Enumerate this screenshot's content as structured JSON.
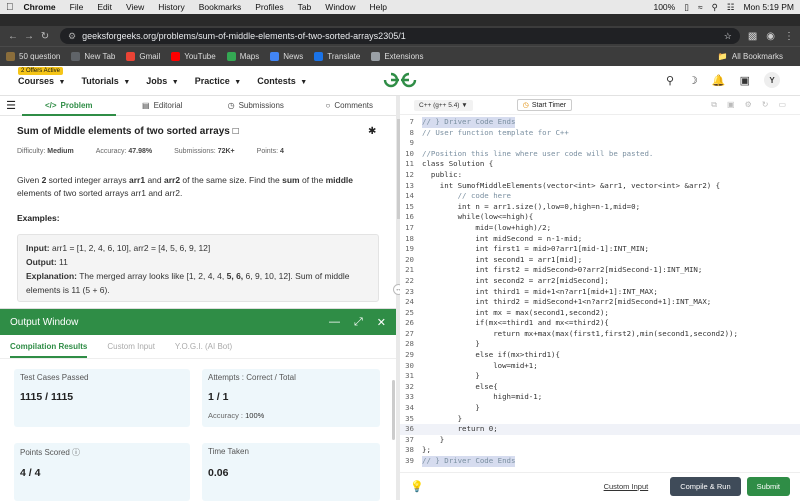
{
  "macbar": {
    "app": "Chrome",
    "menus": [
      "File",
      "Edit",
      "View",
      "History",
      "Bookmarks",
      "Profiles",
      "Tab",
      "Window",
      "Help"
    ],
    "battery": "100%",
    "clock": "Mon 5:19 PM"
  },
  "browser": {
    "url": "geeksforgeeks.org/problems/sum-of-middle-elements-of-two-sorted-arrays2305/1"
  },
  "bookmarks": [
    {
      "label": "50 question",
      "color": "#8a6d3b"
    },
    {
      "label": "New Tab",
      "color": "#5f6368"
    },
    {
      "label": "Gmail",
      "color": "#ea4335"
    },
    {
      "label": "YouTube",
      "color": "#ff0000"
    },
    {
      "label": "Maps",
      "color": "#34a853"
    },
    {
      "label": "News",
      "color": "#4285f4"
    },
    {
      "label": "Translate",
      "color": "#1a73e8"
    },
    {
      "label": "Extensions",
      "color": "#9aa0a6"
    }
  ],
  "all_bookmarks": "All Bookmarks",
  "nav": {
    "offer": "2 Offers Active",
    "courses": "Courses",
    "tutorials": "Tutorials",
    "jobs": "Jobs",
    "practice": "Practice",
    "contests": "Contests",
    "avatar": "Y"
  },
  "problem": {
    "tabs": {
      "problem": "Problem",
      "editorial": "Editorial",
      "submissions": "Submissions",
      "comments": "Comments"
    },
    "title": "Sum of Middle elements of two sorted arrays",
    "difficulty_label": "Difficulty:",
    "difficulty": "Medium",
    "accuracy_label": "Accuracy:",
    "accuracy": "47.98%",
    "submissions_label": "Submissions:",
    "submissions": "72K+",
    "points_label": "Points:",
    "points": "4",
    "desc": {
      "p1": "Given ",
      "p2": "2",
      "p3": " sorted integer arrays ",
      "p4": "arr1",
      "p5": " and ",
      "p6": "arr2",
      "p7": " of the same size. Find the ",
      "p8": "sum",
      "p9": " of the ",
      "p10": "middle",
      "p11": " elements of two sorted arrays arr1 and arr2."
    },
    "examples_heading": "Examples:",
    "example": {
      "input_label": "Input:",
      "input": " arr1 = [1, 2, 4, 6, 10], arr2 = [4, 5, 6, 9, 12]",
      "output_label": "Output:",
      "output": " 11",
      "expl_label": "Explanation:",
      "expl1": " The merged array looks like [1, 2, 4, 4, ",
      "expl2": "5, 6,",
      "expl3": " 6, 9, 10, 12]. Sum of middle elements is 11 (5 + 6)."
    }
  },
  "output": {
    "title": "Output Window",
    "tabs": [
      "Compilation Results",
      "Custom Input",
      "Y.O.G.I. (AI Bot)"
    ],
    "test_label": "Test Cases Passed",
    "test_value": "1115 / 1115",
    "attempts_label": "Attempts : Correct / Total",
    "attempts_value": "1 / 1",
    "accuracy_label": "Accuracy :",
    "accuracy_value": "100%",
    "points_label": "Points Scored",
    "points_value": "4 / 4",
    "time_label": "Time Taken",
    "time_value": "0.06"
  },
  "editor": {
    "language": "C++ (g++ 5.4)",
    "timer": "Start Timer",
    "custom_input": "Custom Input",
    "compile": "Compile & Run",
    "submit": "Submit",
    "lines": [
      {
        "n": "7",
        "t": "// } Driver Code Ends",
        "c": "comment hl"
      },
      {
        "n": "8",
        "t": "// User function template for C++",
        "c": "comment"
      },
      {
        "n": "9",
        "t": "",
        "c": ""
      },
      {
        "n": "10",
        "t": "//Position this line where user code will be pasted.",
        "c": "comment"
      },
      {
        "n": "11",
        "t": "class Solution {",
        "c": ""
      },
      {
        "n": "12",
        "t": "  public:",
        "c": ""
      },
      {
        "n": "13",
        "t": "    int SumofMiddleElements(vector<int> &arr1, vector<int> &arr2) {",
        "c": ""
      },
      {
        "n": "14",
        "t": "        // code here",
        "c": "comment"
      },
      {
        "n": "15",
        "t": "        int n = arr1.size(),low=0,high=n-1,mid=0;",
        "c": ""
      },
      {
        "n": "16",
        "t": "        while(low<=high){",
        "c": ""
      },
      {
        "n": "17",
        "t": "            mid=(low+high)/2;",
        "c": ""
      },
      {
        "n": "18",
        "t": "            int midSecond = n-1-mid;",
        "c": ""
      },
      {
        "n": "19",
        "t": "            int first1 = mid>0?arr1[mid-1]:INT_MIN;",
        "c": ""
      },
      {
        "n": "20",
        "t": "            int second1 = arr1[mid];",
        "c": ""
      },
      {
        "n": "21",
        "t": "            int first2 = midSecond>0?arr2[midSecond-1]:INT_MIN;",
        "c": ""
      },
      {
        "n": "22",
        "t": "            int second2 = arr2[midSecond];",
        "c": ""
      },
      {
        "n": "23",
        "t": "            int third1 = mid+1<n?arr1[mid+1]:INT_MAX;",
        "c": ""
      },
      {
        "n": "24",
        "t": "            int third2 = midSecond+1<n?arr2[midSecond+1]:INT_MAX;",
        "c": ""
      },
      {
        "n": "25",
        "t": "            int mx = max(second1,second2);",
        "c": ""
      },
      {
        "n": "26",
        "t": "            if(mx<=third1 and mx<=third2){",
        "c": ""
      },
      {
        "n": "27",
        "t": "                return mx+max(max(first1,first2),min(second1,second2));",
        "c": ""
      },
      {
        "n": "28",
        "t": "            }",
        "c": ""
      },
      {
        "n": "29",
        "t": "            else if(mx>third1){",
        "c": ""
      },
      {
        "n": "30",
        "t": "                low=mid+1;",
        "c": ""
      },
      {
        "n": "31",
        "t": "            }",
        "c": ""
      },
      {
        "n": "32",
        "t": "            else{",
        "c": ""
      },
      {
        "n": "33",
        "t": "                high=mid-1;",
        "c": ""
      },
      {
        "n": "34",
        "t": "            }",
        "c": ""
      },
      {
        "n": "35",
        "t": "        }",
        "c": ""
      },
      {
        "n": "36",
        "t": "        return 0;",
        "c": "cur"
      },
      {
        "n": "37",
        "t": "    }",
        "c": ""
      },
      {
        "n": "38",
        "t": "};",
        "c": ""
      },
      {
        "n": "39",
        "t": "// } Driver Code Ends",
        "c": "comment hl"
      }
    ]
  }
}
